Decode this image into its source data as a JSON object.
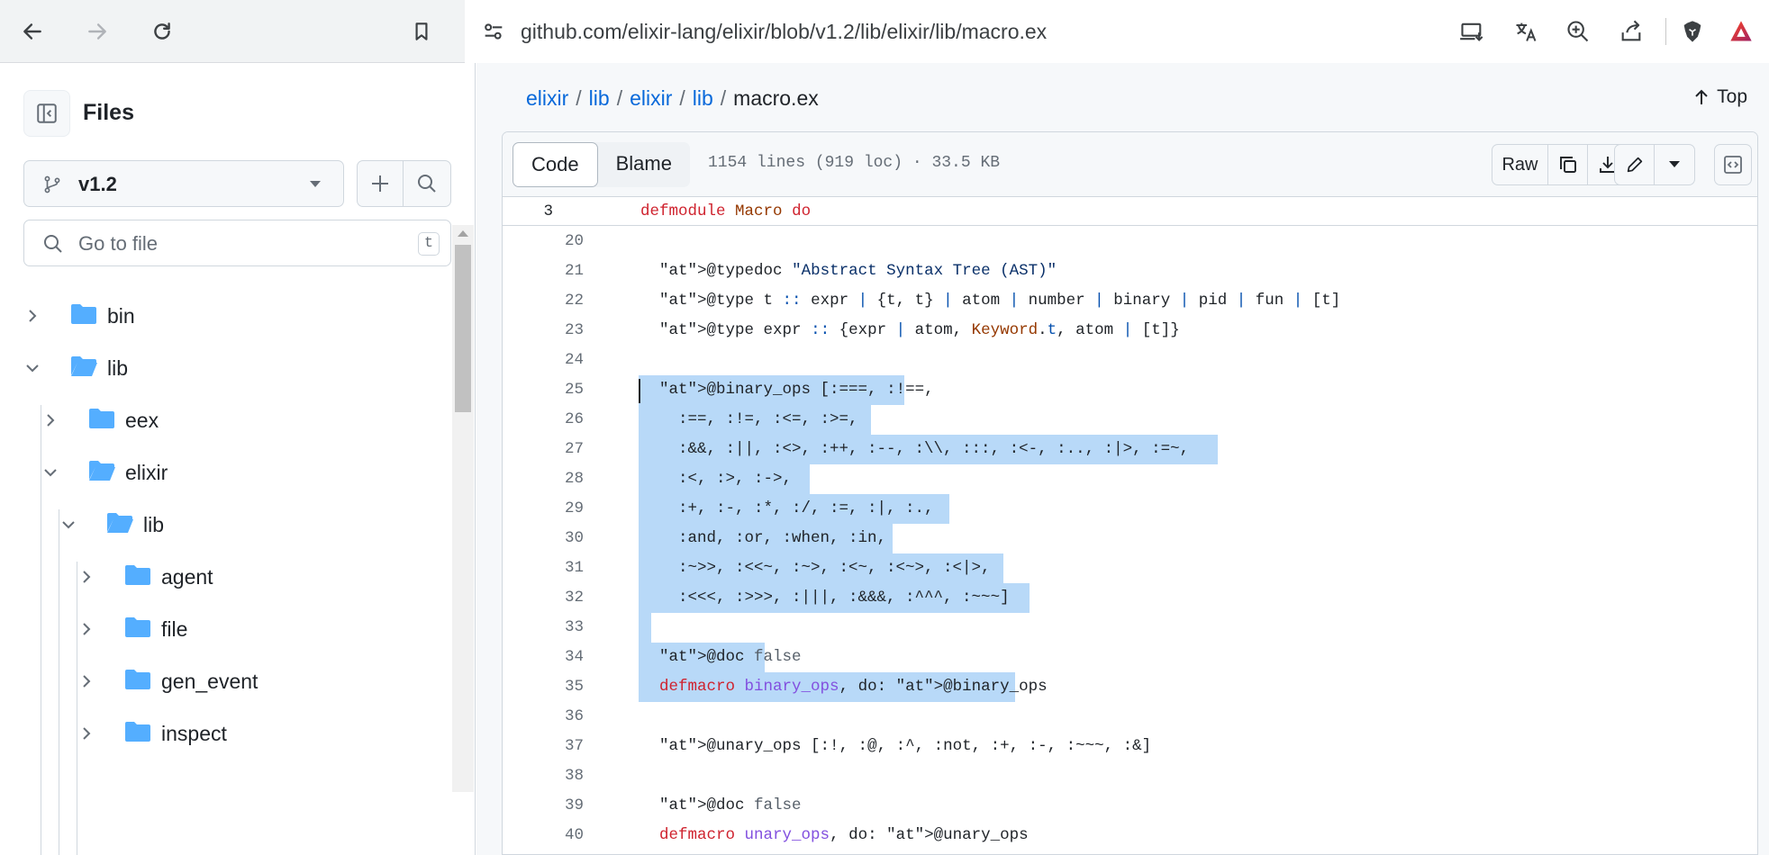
{
  "browser": {
    "url": "github.com/elixir-lang/elixir/blob/v1.2/lib/elixir/lib/macro.ex"
  },
  "sidebar": {
    "title": "Files",
    "branch": "v1.2",
    "goto_placeholder": "Go to file",
    "goto_shortcut": "t",
    "tree": [
      {
        "name": "bin",
        "expanded": false
      },
      {
        "name": "lib",
        "expanded": true
      },
      {
        "name": "eex",
        "expanded": false
      },
      {
        "name": "elixir",
        "expanded": true
      },
      {
        "name": "lib",
        "expanded": true
      },
      {
        "name": "agent",
        "expanded": false
      },
      {
        "name": "file",
        "expanded": false
      },
      {
        "name": "gen_event",
        "expanded": false
      },
      {
        "name": "inspect",
        "expanded": false
      }
    ]
  },
  "breadcrumb": {
    "parts": [
      "elixir",
      "lib",
      "elixir",
      "lib"
    ],
    "separator": "/",
    "current": "macro.ex"
  },
  "top_link": "Top",
  "file_header": {
    "tabs": [
      "Code",
      "Blame"
    ],
    "meta": "1154 lines (919 loc) · 33.5 KB",
    "raw_label": "Raw"
  },
  "sticky": {
    "line": "3",
    "keyword": "defmodule",
    "module": "Macro",
    "do": "do"
  },
  "code_lines": [
    {
      "n": "20",
      "text": ""
    },
    {
      "n": "21",
      "text": "  @typedoc \"Abstract Syntax Tree (AST)\""
    },
    {
      "n": "22",
      "text": "  @type t :: expr | {t, t} | atom | number | binary | pid | fun | [t]"
    },
    {
      "n": "23",
      "text": "  @type expr :: {expr | atom, Keyword.t, atom | [t]}"
    },
    {
      "n": "24",
      "text": ""
    },
    {
      "n": "25",
      "text": "  @binary_ops [:===, :!==,"
    },
    {
      "n": "26",
      "text": "    :==, :!=, :<=, :>=,"
    },
    {
      "n": "27",
      "text": "    :&&, :||, :<>, :++, :--, :\\\\, :::, :<-, :.., :|>, :=~,"
    },
    {
      "n": "28",
      "text": "    :<, :>, :->,"
    },
    {
      "n": "29",
      "text": "    :+, :-, :*, :/, :=, :|, :.,"
    },
    {
      "n": "30",
      "text": "    :and, :or, :when, :in,"
    },
    {
      "n": "31",
      "text": "    :~>>, :<<~, :~>, :<~, :<~>, :<|>,"
    },
    {
      "n": "32",
      "text": "    :<<<, :>>>, :|||, :&&&, :^^^, :~~~]"
    },
    {
      "n": "33",
      "text": ""
    },
    {
      "n": "34",
      "text": "  @doc false"
    },
    {
      "n": "35",
      "text": "  defmacro binary_ops, do: @binary_ops"
    },
    {
      "n": "36",
      "text": ""
    },
    {
      "n": "37",
      "text": "  @unary_ops [:!, :@, :^, :not, :+, :-, :~~~, :&]"
    },
    {
      "n": "38",
      "text": ""
    },
    {
      "n": "39",
      "text": "  @doc false"
    },
    {
      "n": "40",
      "text": "  defmacro unary_ops, do: @unary_ops"
    }
  ],
  "selected_lines": [
    "25",
    "26",
    "27",
    "28",
    "29",
    "30",
    "31",
    "32",
    "33",
    "34",
    "35"
  ],
  "colors": {
    "link": "#0969da",
    "selection": "#b8d9f8",
    "folder": "#54aeff",
    "keyword": "#cf222e",
    "attribute": "#0550ae",
    "function": "#8250df"
  },
  "icons": {
    "back": "arrow-left-icon",
    "forward": "arrow-right-icon",
    "reload": "reload-icon",
    "bookmark": "bookmark-icon",
    "site_settings": "tune-icon",
    "install": "install-app-icon",
    "translate": "translate-icon",
    "zoom": "zoom-in-icon",
    "share": "share-icon",
    "brave": "brave-lion-icon",
    "rewards": "brave-rewards-icon"
  }
}
